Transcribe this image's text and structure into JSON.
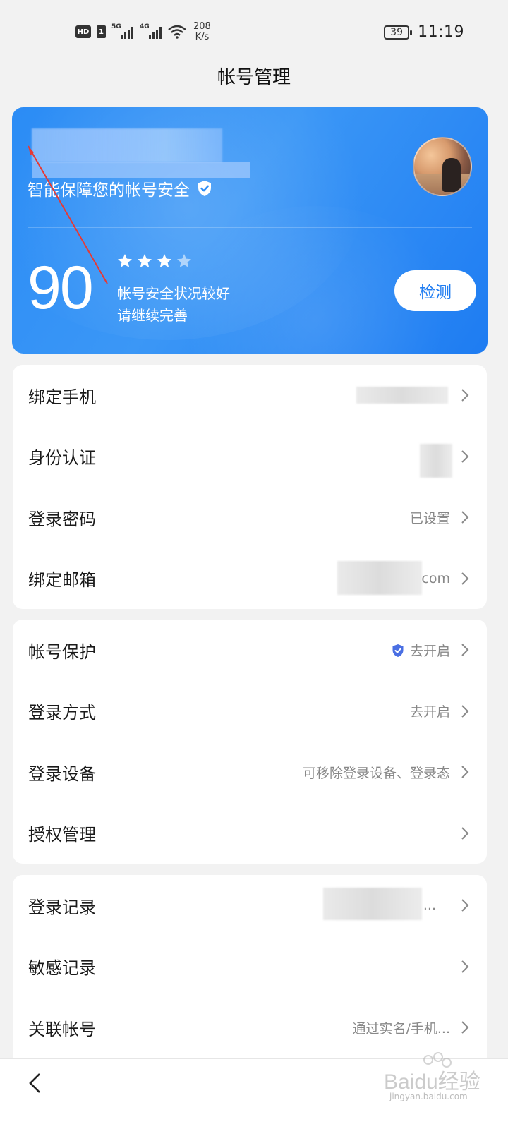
{
  "status_bar": {
    "hd_label": "HD",
    "sim_label": "1",
    "network1": "5G",
    "network2": "4G",
    "speed_value": "208",
    "speed_unit": "K/s",
    "battery": "39",
    "time": "11:19"
  },
  "header": {
    "title": "帐号管理"
  },
  "hero": {
    "subtitle": "智能保障您的帐号安全",
    "score": "90",
    "stars": 3.5,
    "status_line1": "帐号安全状况较好",
    "status_line2": "请继续完善",
    "detect_label": "检测"
  },
  "section1": [
    {
      "label": "绑定手机",
      "value": ""
    },
    {
      "label": "身份认证",
      "value": ""
    },
    {
      "label": "登录密码",
      "value": "已设置"
    },
    {
      "label": "绑定邮箱",
      "value": "com"
    }
  ],
  "section2": [
    {
      "label": "帐号保护",
      "value": "去开启"
    },
    {
      "label": "登录方式",
      "value": "去开启"
    },
    {
      "label": "登录设备",
      "value": "可移除登录设备、登录态"
    },
    {
      "label": "授权管理",
      "value": ""
    }
  ],
  "section3": [
    {
      "label": "登录记录",
      "value": "..."
    },
    {
      "label": "敏感记录",
      "value": ""
    },
    {
      "label": "关联帐号",
      "value": "通过实名/手机..."
    }
  ],
  "watermark": {
    "brand": "Baidu经验",
    "url": "jingyan.baidu.com"
  },
  "colors": {
    "accent": "#1e7cf2",
    "hero_start": "#2b8cf5",
    "annotation": "#e53935"
  },
  "icons": [
    "hd-icon",
    "signal-icon",
    "wifi-icon",
    "battery-icon",
    "shield-check-icon",
    "star-icon",
    "chevron-right-icon",
    "back-icon"
  ]
}
